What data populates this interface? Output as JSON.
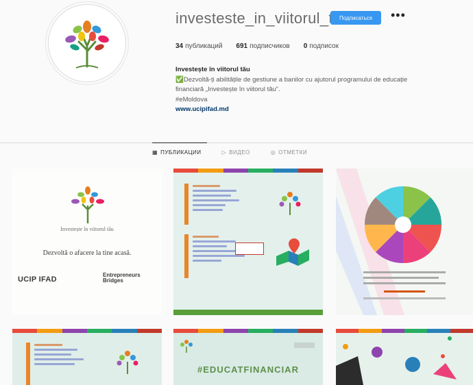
{
  "profile": {
    "username": "investeste_in_viitorul_tau",
    "follow_label": "Подписаться",
    "more_label": "•••"
  },
  "stats": {
    "posts": "34",
    "posts_label": "публикаций",
    "followers": "691",
    "followers_label": "подписчиков",
    "following": "0",
    "following_label": "подписок"
  },
  "bio": {
    "name": "Investește în viitorul tău",
    "line1": "✅Dezvoltă-ți abilitățile de gestiune a banilor cu ajutorul programului de educație",
    "line2": "financiară „Investește în viitorul tău”.",
    "line3": "#eMoldova",
    "link": "www.ucipifad.md"
  },
  "tabs": [
    {
      "label": "ПУБЛИКАЦИИ"
    },
    {
      "label": "ВИДЕО"
    },
    {
      "label": "ОТМЕТКИ"
    }
  ],
  "posts": {
    "tile1": {
      "caption_top": "Investește în viitorul tău",
      "caption_main": "Dezvoltă o afacere la tine acasă.",
      "logo1": "UCIP IFAD",
      "logo2": "Entrepreneurs Bridges"
    },
    "tile5": {
      "hashtag": "#EDUCATFINANCIAR"
    }
  },
  "colors": {
    "accent": "#3897f0",
    "stripe": [
      "#e74b3c",
      "#f39c12",
      "#8e44ad",
      "#27ae60",
      "#2980b9",
      "#c0392b"
    ]
  }
}
